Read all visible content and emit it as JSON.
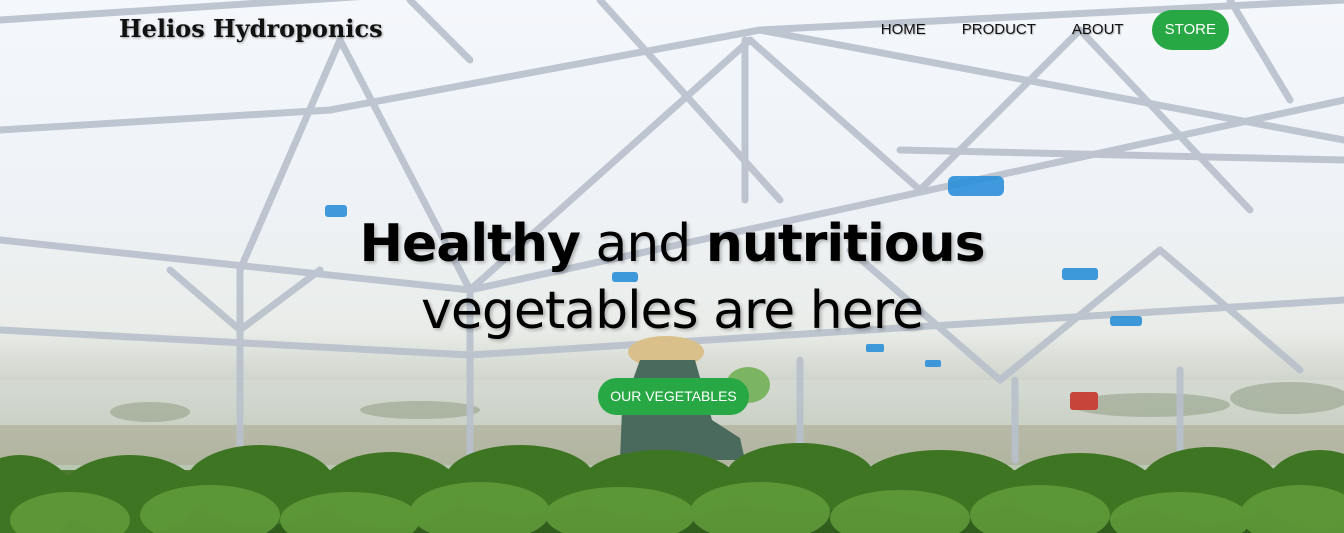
{
  "brand": {
    "name": "Helios Hydroponics"
  },
  "nav": {
    "items": [
      {
        "label": "HOME"
      },
      {
        "label": "PRODUCT"
      },
      {
        "label": "ABOUT"
      }
    ],
    "store_label": "STORE"
  },
  "hero": {
    "headline_bold_1": "Healthy",
    "headline_mid": " and ",
    "headline_bold_2": "nutritious",
    "headline_line2": "vegetables are here",
    "cta_label": "OUR VEGETABLES",
    "background_image": "greenhouse-with-worker-harvesting-lettuce"
  },
  "colors": {
    "accent": "#28a745",
    "text": "#111111",
    "button_text": "#ffffff"
  }
}
